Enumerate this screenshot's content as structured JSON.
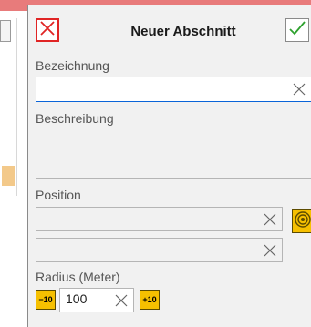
{
  "dialog": {
    "title": "Neuer Abschnitt",
    "colors": {
      "close": "#e02424",
      "ok": "#2ea12e",
      "accent": "#f6c000",
      "focus": "#0a64d8"
    }
  },
  "fields": {
    "name_label": "Bezeichnung",
    "name_value": "",
    "description_label": "Beschreibung",
    "description_value": "",
    "position_label": "Position",
    "position_value_1": "",
    "position_value_2": "",
    "radius_label": "Radius (Meter)",
    "radius_value": "100"
  },
  "buttons": {
    "decrease_label": "−10",
    "increase_label": "+10",
    "close_icon": "close-icon",
    "ok_icon": "check-icon",
    "target_icon": "target-icon"
  }
}
